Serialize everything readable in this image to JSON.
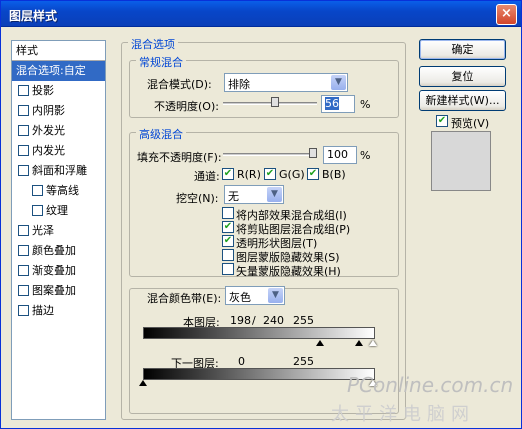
{
  "window": {
    "title": "图层样式",
    "close": "×"
  },
  "styles": {
    "header": "样式",
    "items": [
      {
        "label": "混合选项:自定",
        "selected": true
      },
      {
        "label": "投影"
      },
      {
        "label": "内阴影"
      },
      {
        "label": "外发光"
      },
      {
        "label": "内发光"
      },
      {
        "label": "斜面和浮雕"
      },
      {
        "label": "等高线",
        "sub": true
      },
      {
        "label": "纹理",
        "sub": true
      },
      {
        "label": "光泽"
      },
      {
        "label": "颜色叠加"
      },
      {
        "label": "渐变叠加"
      },
      {
        "label": "图案叠加"
      },
      {
        "label": "描边"
      }
    ]
  },
  "blend_options": {
    "title": "混合选项",
    "general": {
      "title": "常规混合",
      "mode_label": "混合模式(D):",
      "mode_value": "排除",
      "opacity_label": "不透明度(O):",
      "opacity_value": "56",
      "percent": "%",
      "opacity_fraction": 0.56
    },
    "advanced": {
      "title": "高级混合",
      "fill_label": "填充不透明度(F):",
      "fill_value": "100",
      "percent": "%",
      "fill_fraction": 1.0,
      "channels_label": "通道:",
      "channels": [
        "R(R)",
        "G(G)",
        "B(B)"
      ],
      "knockout_label": "挖空(N):",
      "knockout_value": "无",
      "options": [
        {
          "label": "将内部效果混合成组(I)",
          "checked": false
        },
        {
          "label": "将剪贴图层混合成组(P)",
          "checked": true
        },
        {
          "label": "透明形状图层(T)",
          "checked": true
        },
        {
          "label": "图层蒙版隐藏效果(S)",
          "checked": false
        },
        {
          "label": "矢量蒙版隐藏效果(H)",
          "checked": false
        }
      ]
    },
    "blend_if": {
      "label": "混合颜色带(E):",
      "value": "灰色",
      "this_layer": {
        "label": "本图层:",
        "v1": "198",
        "sep": "/",
        "v2": "240",
        "v3": "255"
      },
      "underlying": {
        "label": "下一图层:",
        "v1": "0",
        "v2": "255"
      }
    }
  },
  "buttons": {
    "ok": "确定",
    "reset": "复位",
    "new_style": "新建样式(W)...",
    "preview": "预览(V)"
  },
  "watermark": {
    "line1": "PConline.com.cn",
    "line2": "太平洋电脑网"
  },
  "check_mark": "✔",
  "arrow_glyph": "▼"
}
